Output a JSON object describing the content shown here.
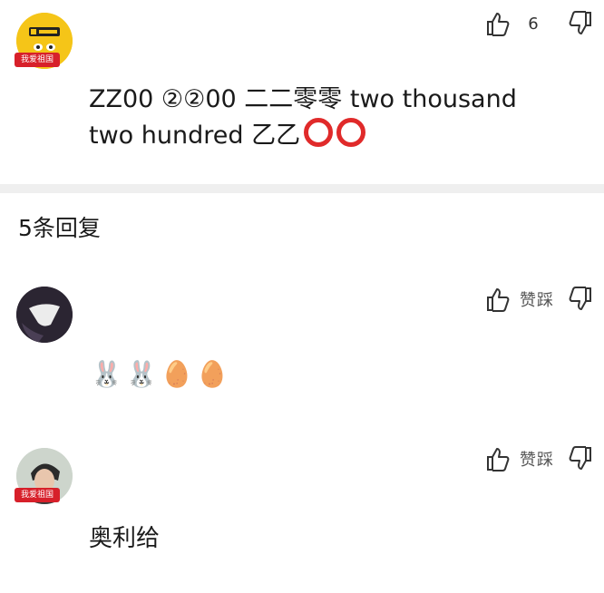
{
  "comment": {
    "likes": "6",
    "badge_text": "我爱祖国",
    "text": "ZZ00 ②②00 二二零零 two thousand two hundred 乙乙"
  },
  "replies_header": "5条回复",
  "replies": [
    {
      "like_label": "赞",
      "dislike_label": "踩",
      "emojis": [
        "🐰",
        "🐰",
        "🥚",
        "🥚"
      ]
    },
    {
      "like_label": "赞",
      "dislike_label": "踩",
      "badge_text": "我爱祖国",
      "text": "奥利给"
    }
  ],
  "icons": {
    "like": "thumbs-up-outline-icon",
    "dislike": "thumbs-down-outline-icon"
  },
  "colors": {
    "badge_red": "#d7202a",
    "ring_red": "#e02a2a",
    "divider": "#efefef"
  }
}
